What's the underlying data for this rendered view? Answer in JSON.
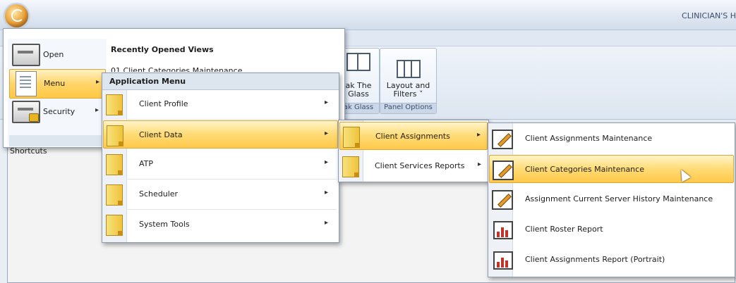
{
  "window": {
    "title": "CLINICIAN'S H"
  },
  "ribbon": {
    "break_glass_label_1": "ak The",
    "break_glass_label_2": "Glass",
    "break_glass_group": "ak Glass",
    "layout_label_1": "Layout and",
    "layout_label_2": "Filters ˅",
    "layout_group": "Panel Options"
  },
  "workspace": {
    "shortcuts_label": "Shortcuts"
  },
  "app_menu": {
    "items": [
      {
        "label": "Open",
        "icon": "monitor-icon",
        "arrow": ""
      },
      {
        "label": "Menu",
        "icon": "document-icon",
        "arrow": "▸"
      },
      {
        "label": "Security",
        "icon": "lock-monitor-icon",
        "arrow": "▸"
      }
    ],
    "recent_title": "Recently Opened Views",
    "recent_items": [
      "01 Client Categories Maintenance"
    ]
  },
  "application_menu": {
    "title": "Application Menu",
    "items": [
      {
        "label": "Client Profile",
        "arrow": "▸"
      },
      {
        "label": "Client Data",
        "arrow": "▸"
      },
      {
        "label": "ATP",
        "arrow": "▸"
      },
      {
        "label": "Scheduler",
        "arrow": "▸"
      },
      {
        "label": "System Tools",
        "arrow": "▸"
      }
    ]
  },
  "client_data_menu": {
    "items": [
      {
        "label": "Client Assignments",
        "arrow": "▸"
      },
      {
        "label": "Client Services Reports",
        "arrow": "▸"
      }
    ]
  },
  "client_assignments_menu": {
    "items": [
      {
        "label": "Client Assignments Maintenance",
        "icon": "edit-icon"
      },
      {
        "label": "Client Categories Maintenance",
        "icon": "edit-icon"
      },
      {
        "label": "Assignment Current Server History Maintenance",
        "icon": "edit-icon"
      },
      {
        "label": "Client Roster Report",
        "icon": "report-icon"
      },
      {
        "label": "Client Assignments Report (Portrait)",
        "icon": "report-icon"
      }
    ]
  },
  "colors": {
    "highlight": "#ffd56a",
    "menu_border": "#8e9cb2",
    "folder": "#f1c93f"
  }
}
